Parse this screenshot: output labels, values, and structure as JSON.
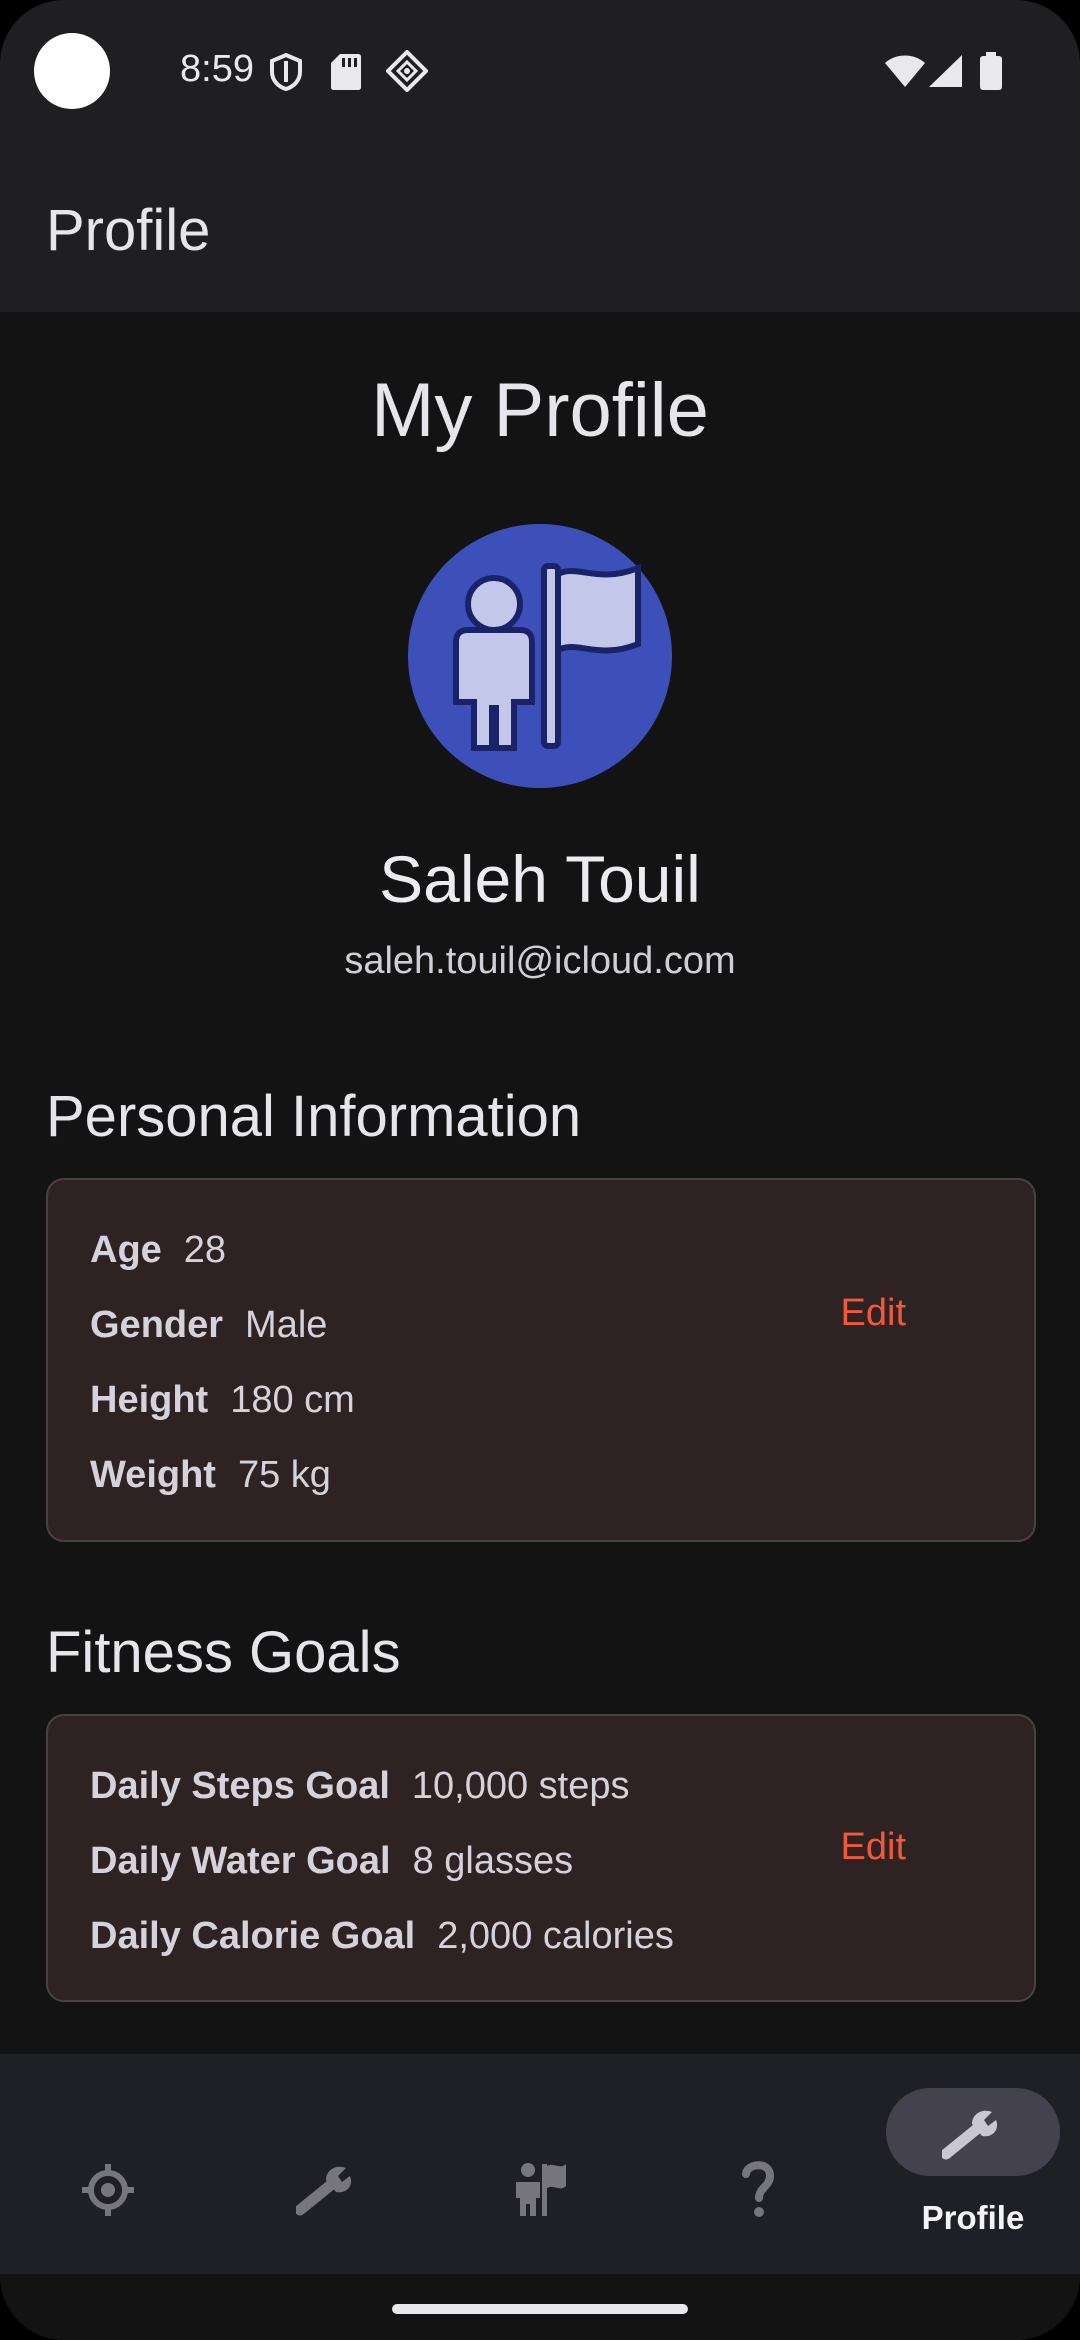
{
  "status_bar": {
    "time": "8:59",
    "left_icons": [
      "shield-icon",
      "sd-card-icon",
      "diamond-grid-icon"
    ],
    "right_icons": [
      "wifi-icon",
      "signal-icon",
      "battery-icon"
    ]
  },
  "app_bar": {
    "title": "Profile"
  },
  "profile": {
    "heading": "My Profile",
    "avatar_icon": "person-flag-icon",
    "name": "Saleh Touil",
    "email": "saleh.touil@icloud.com"
  },
  "personal_info": {
    "title": "Personal Information",
    "edit_label": "Edit",
    "rows": [
      {
        "label": "Age",
        "value": "28"
      },
      {
        "label": "Gender",
        "value": "Male"
      },
      {
        "label": "Height",
        "value": "180 cm"
      },
      {
        "label": "Weight",
        "value": "75 kg"
      }
    ]
  },
  "fitness_goals": {
    "title": "Fitness Goals",
    "edit_label": "Edit",
    "rows": [
      {
        "label": "Daily Steps Goal",
        "value": "10,000 steps"
      },
      {
        "label": "Daily Water Goal",
        "value": "8 glasses"
      },
      {
        "label": "Daily Calorie Goal",
        "value": "2,000 calories"
      }
    ]
  },
  "bottom_nav": {
    "items": [
      {
        "icon": "crosshair-icon",
        "active": false
      },
      {
        "icon": "wrench-icon",
        "active": false
      },
      {
        "icon": "person-flag-icon",
        "active": false
      },
      {
        "icon": "question-icon",
        "active": false
      },
      {
        "icon": "wrench-icon",
        "active": true,
        "label": "Profile"
      }
    ]
  },
  "colors": {
    "background": "#131314",
    "bar": "#1f1f21",
    "card": "#2e2322",
    "accent": "#f0593a",
    "avatar": "#3d4fb8"
  }
}
